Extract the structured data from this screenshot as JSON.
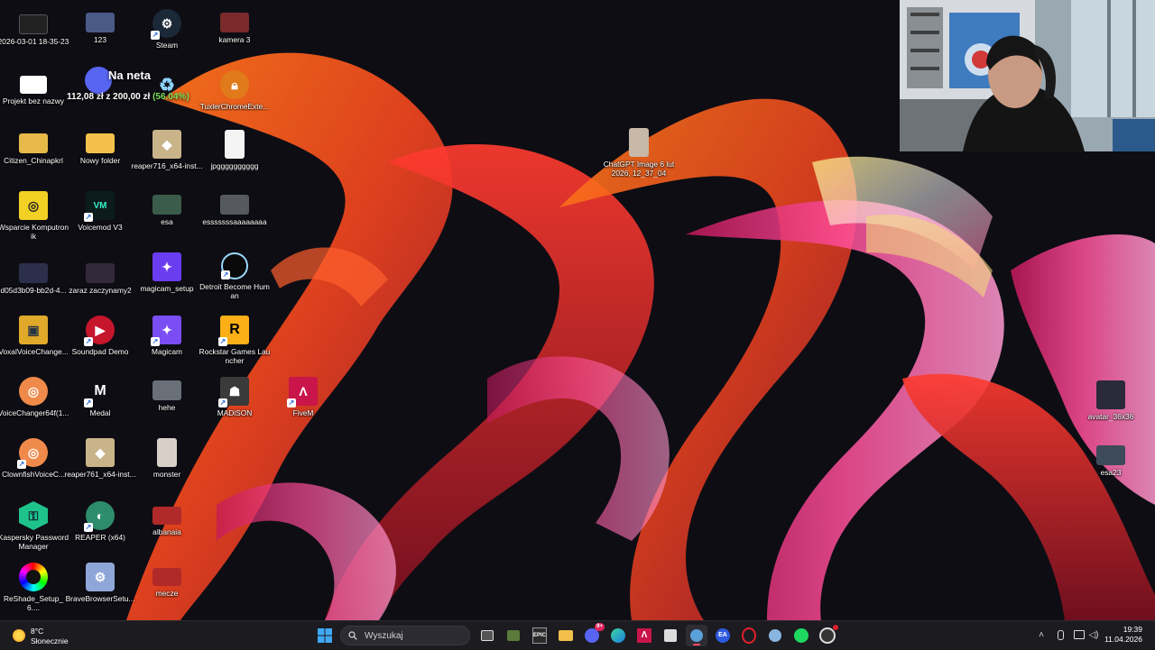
{
  "overlay": {
    "title": "Na neta",
    "amount": "112,08 zł z 200,00 zł",
    "percent": "(56.04%)",
    "progress_fraction": 0.5604
  },
  "desktop_icons": {
    "c0_r0": "2026-03-01 18-35-23",
    "c1_r0": "123",
    "c2_r0": "Steam",
    "c3_r0": "kamera 3",
    "c0_r1": "Projekt bez nazwy",
    "c1_r1": "",
    "c2_r1": "",
    "c3_r1": "TuxlerChromeExte...",
    "c0_r2": "Citizen_Chinapkrl",
    "c1_r2": "Nowy folder",
    "c2_r2": "reaper716_x64-inst...",
    "c3_r2": "jpgggggggggg",
    "c0_r3": "Wsparcie Komputronik",
    "c1_r3": "Voicemod V3",
    "c2_r3": "esa",
    "c3_r3": "esssssssaaaaaaaa",
    "c0_r4": "d05d3b09-bb2d-4...",
    "c1_r4": "zaraz zaczynamy2",
    "c2_r4": "magicam_setup",
    "c3_r4": "Detroit Become Human",
    "c0_r5": "VoxalVoiceChange...",
    "c1_r5": "Soundpad Demo",
    "c2_r5": "Magicam",
    "c3_r5": "Rockstar Games Launcher",
    "c0_r6": "VoiceChanger64f(1...",
    "c1_r6": "Medal",
    "c2_r6": "hehe",
    "c3_r6": "MADiSON",
    "c4_r6": "FiveM",
    "c0_r7": "ClownfishVoiceC...",
    "c1_r7": "reaper761_x64-inst...",
    "c2_r7": "monster",
    "c0_r8": "Kaspersky Password Manager",
    "c1_r8": "REAPER (x64)",
    "c2_r8": "albanaia",
    "c0_r9": "ReShade_Setup_6....",
    "c1_r9": "BraveBrowserSetu...",
    "c2_r9": "mecze",
    "chatgpt": "ChatGPT Image 6 lut 2026, 12_37_04",
    "avatar": "avatar_36x36",
    "esa23": "esa23"
  },
  "taskbar": {
    "search_placeholder": "Wyszukaj",
    "weather_temp": "8°C",
    "weather_cond": "Słonecznie",
    "time": "19:39",
    "date": "11.04.2026",
    "discord_badge": "9+"
  },
  "colors": {
    "taskbar_bg": "#1c1b20",
    "accent": "#ff4b6e",
    "progress_green": "#7de05a"
  }
}
